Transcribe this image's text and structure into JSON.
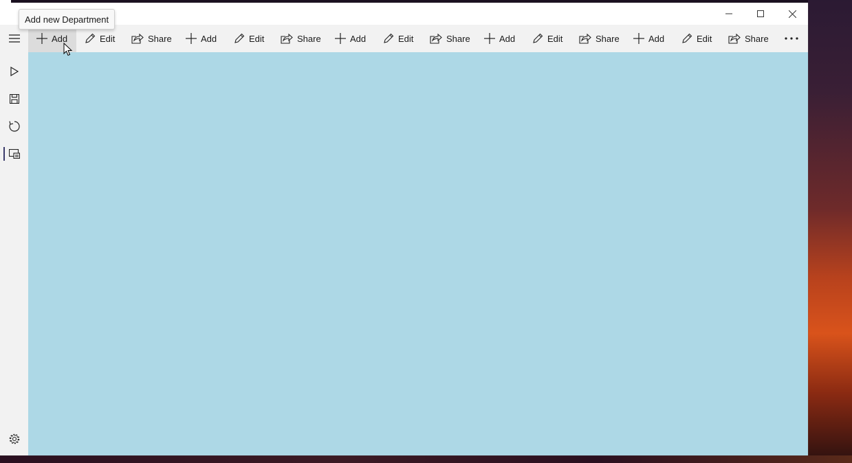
{
  "window": {
    "tooltip": "Add new Department",
    "caption_buttons": [
      "minimize-icon",
      "maximize-icon",
      "close-icon"
    ]
  },
  "commandbar": {
    "items": [
      {
        "label": "Add",
        "icon": "plus-icon"
      },
      {
        "label": "Edit",
        "icon": "pencil-icon"
      },
      {
        "label": "Share",
        "icon": "share-icon"
      },
      {
        "label": "Add",
        "icon": "plus-icon"
      },
      {
        "label": "Edit",
        "icon": "pencil-icon"
      },
      {
        "label": "Share",
        "icon": "share-icon"
      },
      {
        "label": "Add",
        "icon": "plus-icon"
      },
      {
        "label": "Edit",
        "icon": "pencil-icon"
      },
      {
        "label": "Share",
        "icon": "share-icon"
      },
      {
        "label": "Add",
        "icon": "plus-icon"
      },
      {
        "label": "Edit",
        "icon": "pencil-icon"
      },
      {
        "label": "Share",
        "icon": "share-icon"
      },
      {
        "label": "Add",
        "icon": "plus-icon"
      },
      {
        "label": "Edit",
        "icon": "pencil-icon"
      },
      {
        "label": "Share",
        "icon": "share-icon"
      }
    ],
    "overflow_icon": "more-icon"
  },
  "sidebar": {
    "items": [
      "hamburger-icon",
      "play-icon",
      "save-icon",
      "refresh-icon",
      "view-icon"
    ],
    "footer": "settings-icon"
  },
  "colors": {
    "content_background": "#add8e6",
    "chrome_background": "#f2f2f2"
  }
}
